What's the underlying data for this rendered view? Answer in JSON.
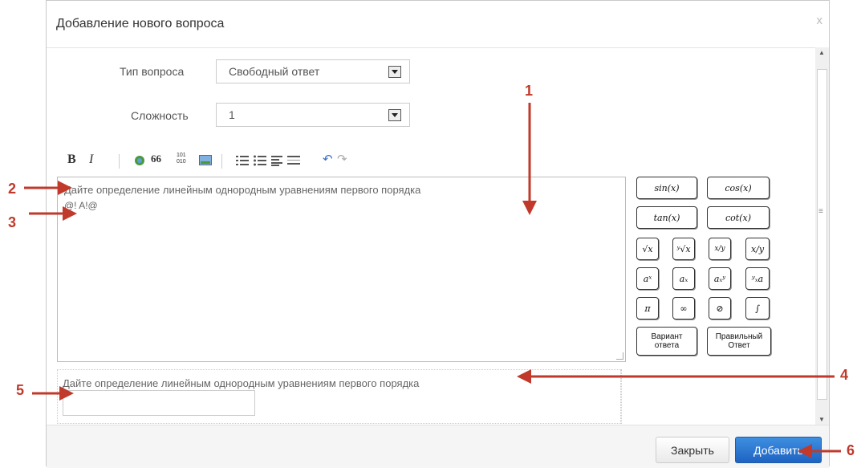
{
  "dialog": {
    "title": "Добавление нового вопроса",
    "close_glyph": "x"
  },
  "form": {
    "type_label": "Тип вопроса",
    "type_value": "Свободный ответ",
    "difficulty_label": "Сложность",
    "difficulty_value": "1"
  },
  "toolbar": {
    "bold": "B",
    "italic": "I",
    "quote": "66",
    "binary_top": "101",
    "binary_bottom": "010",
    "icons": [
      "link-icon",
      "quote-icon",
      "code-icon",
      "image-icon",
      "ordered-list-icon",
      "unordered-list-icon",
      "align-icon",
      "rule-icon",
      "undo-icon",
      "redo-icon"
    ]
  },
  "editor": {
    "line1": "Дайте определение линейным однородным уравнениям первого порядка",
    "line2": "@! A!@"
  },
  "math_buttons": [
    {
      "id": "sin",
      "label": "sin(x)"
    },
    {
      "id": "cos",
      "label": "cos(x)"
    },
    {
      "id": "tan",
      "label": "tan(x)"
    },
    {
      "id": "cot",
      "label": "cot(x)"
    },
    {
      "id": "sqrt",
      "label": "√x"
    },
    {
      "id": "nroot",
      "label": "ʸ√x"
    },
    {
      "id": "frac",
      "label": "x/y"
    },
    {
      "id": "slash",
      "label": "x/y"
    },
    {
      "id": "power",
      "label": "aˣ"
    },
    {
      "id": "sub",
      "label": "aₓ"
    },
    {
      "id": "subsup",
      "label": "aₓʸ"
    },
    {
      "id": "presub",
      "label": "ʸₓa"
    },
    {
      "id": "pi",
      "label": "π"
    },
    {
      "id": "inf",
      "label": "∞"
    },
    {
      "id": "empty",
      "label": "⊘"
    },
    {
      "id": "integral",
      "label": "∫"
    }
  ],
  "answer_buttons": {
    "variant_line1": "Вариант",
    "variant_line2": "ответа",
    "correct_line1": "Правильный",
    "correct_line2": "Ответ"
  },
  "answer": {
    "text": "Дайте определение линейным однородным уравнениям первого порядка"
  },
  "footer": {
    "close_label": "Закрыть",
    "add_label": "Добавить"
  },
  "annotations": {
    "n1": "1",
    "n2": "2",
    "n3": "3",
    "n4": "4",
    "n5": "5",
    "n6": "6",
    "color": "#c0392b"
  },
  "colors": {
    "primary_button": "#2a75d3",
    "border": "#cccccc"
  }
}
